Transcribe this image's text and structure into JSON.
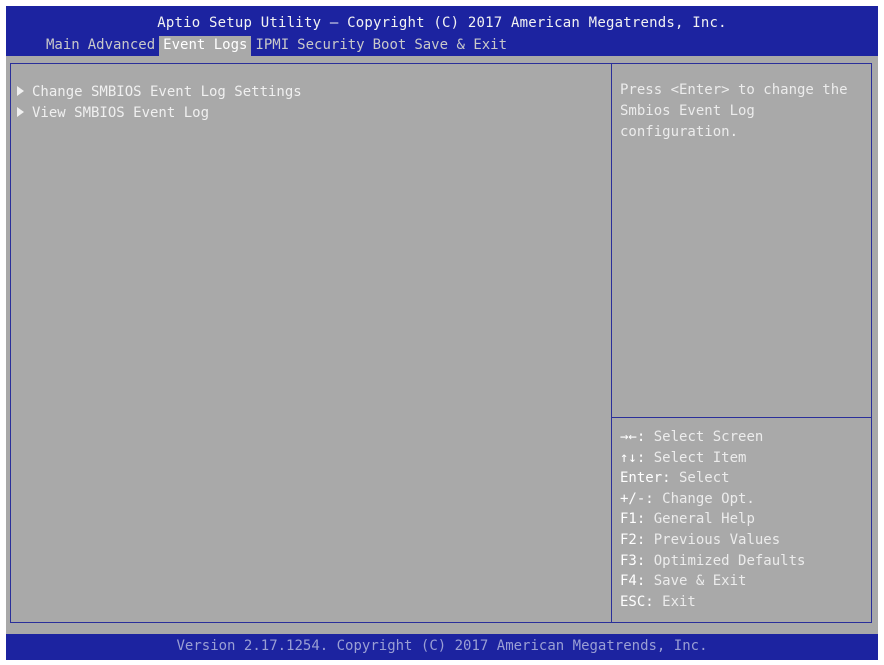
{
  "header": {
    "title": "Aptio Setup Utility – Copyright (C) 2017 American Megatrends, Inc."
  },
  "tabs": [
    {
      "label": "Main"
    },
    {
      "label": "Advanced"
    },
    {
      "label": "Event Logs"
    },
    {
      "label": "IPMI"
    },
    {
      "label": "Security"
    },
    {
      "label": "Boot"
    },
    {
      "label": "Save & Exit"
    }
  ],
  "active_tab": "Event Logs",
  "menu": {
    "items": [
      {
        "label": "Change SMBIOS Event Log Settings"
      },
      {
        "label": "View SMBIOS Event Log"
      }
    ]
  },
  "help": {
    "text": "Press <Enter> to change the\nSmbios Event Log\nconfiguration."
  },
  "keys": [
    {
      "key": "→←:",
      "desc": " Select Screen"
    },
    {
      "key": "↑↓:",
      "desc": " Select Item"
    },
    {
      "key": "Enter:",
      "desc": " Select"
    },
    {
      "key": "+/-:",
      "desc": " Change Opt."
    },
    {
      "key": "F1:",
      "desc": " General Help"
    },
    {
      "key": "F2:",
      "desc": " Previous Values"
    },
    {
      "key": "F3:",
      "desc": " Optimized Defaults"
    },
    {
      "key": "F4:",
      "desc": " Save & Exit"
    },
    {
      "key": "ESC:",
      "desc": " Exit"
    }
  ],
  "footer": {
    "text": "Version 2.17.1254. Copyright (C) 2017 American Megatrends, Inc."
  },
  "colors": {
    "header_bg": "#1c23a0",
    "body_bg": "#a9a9a9",
    "text": "#f0f0f0",
    "border": "#2a2f9a"
  }
}
